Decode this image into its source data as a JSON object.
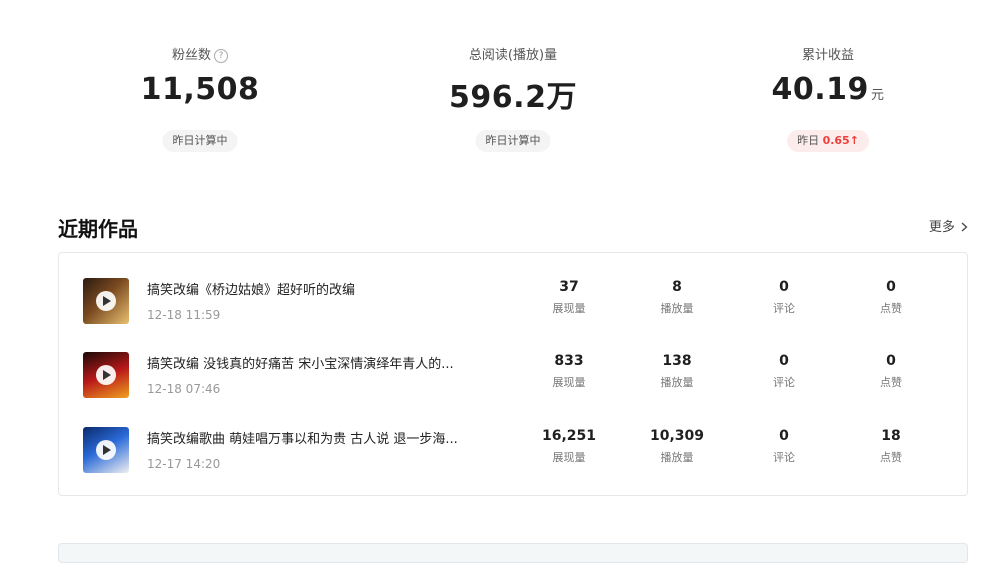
{
  "stats": [
    {
      "label": "粉丝数",
      "value": "11,508",
      "unit": "",
      "badge": "昨日计算中"
    },
    {
      "label": "总阅读(播放)量",
      "value": "596.2万",
      "unit": "",
      "badge": "昨日计算中"
    },
    {
      "label": "累计收益",
      "value": "40.19",
      "unit": "元",
      "badge_prefix": "昨日",
      "badge_value": "0.65",
      "badge_arrow": "↑"
    }
  ],
  "help_icon": "?",
  "section": {
    "title": "近期作品",
    "more": "更多"
  },
  "works": [
    {
      "title": "搞笑改编《桥边姑娘》超好听的改编",
      "time": "12-18 11:59",
      "metrics": [
        {
          "value": "37",
          "label": "展现量"
        },
        {
          "value": "8",
          "label": "播放量"
        },
        {
          "value": "0",
          "label": "评论"
        },
        {
          "value": "0",
          "label": "点赞"
        }
      ]
    },
    {
      "title": "搞笑改编 没钱真的好痛苦 宋小宝深情演绎年青人的...",
      "time": "12-18 07:46",
      "metrics": [
        {
          "value": "833",
          "label": "展现量"
        },
        {
          "value": "138",
          "label": "播放量"
        },
        {
          "value": "0",
          "label": "评论"
        },
        {
          "value": "0",
          "label": "点赞"
        }
      ]
    },
    {
      "title": "搞笑改编歌曲 萌娃唱万事以和为贵 古人说 退一步海...",
      "time": "12-17 14:20",
      "metrics": [
        {
          "value": "16,251",
          "label": "展现量"
        },
        {
          "value": "10,309",
          "label": "播放量"
        },
        {
          "value": "0",
          "label": "评论"
        },
        {
          "value": "18",
          "label": "点赞"
        }
      ]
    }
  ],
  "colors": {
    "accent_red": "#f0403c"
  }
}
